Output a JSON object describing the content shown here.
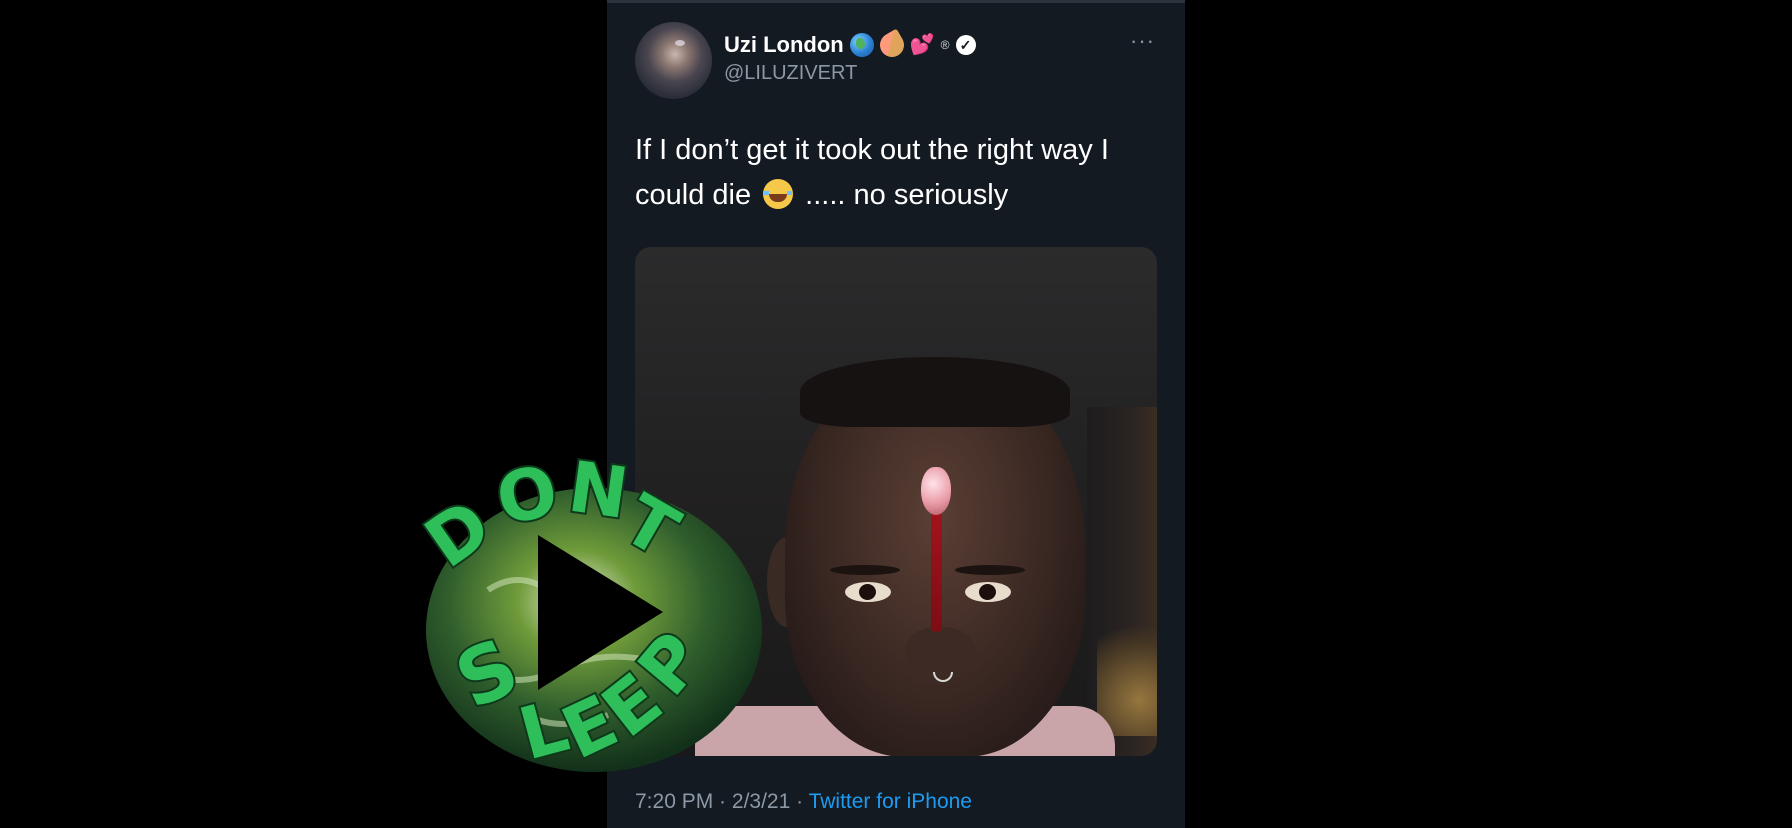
{
  "tweet": {
    "display_name": "Uzi London",
    "handle": "@LILUZIVERT",
    "name_emojis": [
      "globe-emoji",
      "ice-cream-emoji",
      "two-hearts-emoji",
      "registered-sign",
      "verified-badge"
    ],
    "registered_mark": "®",
    "verified_mark": "✓",
    "more_label": "···",
    "text_line1": "If I don’t get it took out the right way I",
    "text_line2_a": "could die",
    "text_line2_b": "..... no seriously",
    "text_emoji": "face-with-tears-of-joy",
    "time": "7:20 PM",
    "separator": " · ",
    "date": "2/3/21",
    "source": "Twitter for iPhone"
  },
  "watermark": {
    "logo_text": "DONT SLEEP",
    "icon": "play-icon",
    "colors": {
      "letters": "#2fbf5a",
      "outline": "#0d3a1a",
      "play": "#000000"
    }
  },
  "colors": {
    "background": "#000000",
    "card": "#141a22",
    "primary_text": "#ffffff",
    "secondary_text": "#8b98a5",
    "link": "#1d9bf0"
  }
}
